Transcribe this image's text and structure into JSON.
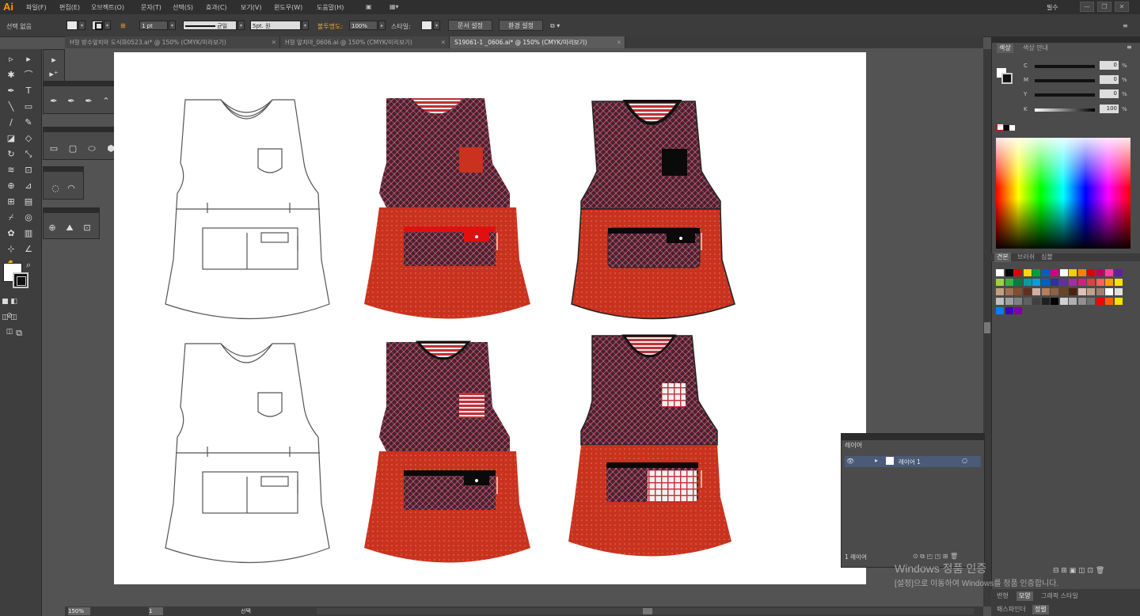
{
  "app": {
    "logo": "Ai"
  },
  "menu": [
    "파일(F)",
    "편집(E)",
    "오브젝트(O)",
    "문자(T)",
    "선택(S)",
    "효과(C)",
    "보기(V)",
    "윈도우(W)",
    "도움말(H)"
  ],
  "workspace": "필수",
  "window_controls": [
    "—",
    "❐",
    "✕"
  ],
  "control_bar": {
    "selection_label": "선택 없음",
    "stroke_weight": "1 pt",
    "stroke_style": "균일",
    "brush": "5pt. 원",
    "opacity_label": "불투명도:",
    "opacity_value": "100%",
    "style_label": "스타일:",
    "doc_setup": "문서 설정",
    "preferences": "환경 설정"
  },
  "tabs": [
    {
      "label": "H형 방수앞치마 도식화0523.ai* @ 150% (CMYK/미리보기)",
      "active": false
    },
    {
      "label": "H형 앞치마_0606.ai @ 150% (CMYK/미리보기)",
      "active": false
    },
    {
      "label": "S19061-1 _0606.ai* @ 150% (CMYK/미리보기)",
      "active": true
    }
  ],
  "color_panel": {
    "tabs": [
      "색상",
      "색상 안내"
    ],
    "channels": [
      {
        "name": "C",
        "value": "0"
      },
      {
        "name": "M",
        "value": "0"
      },
      {
        "name": "Y",
        "value": "0"
      },
      {
        "name": "K",
        "value": "100"
      }
    ],
    "pct": "%"
  },
  "swatch_panel": {
    "tabs": [
      "견본",
      "브러쉬",
      "심볼"
    ]
  },
  "layers_panel": {
    "title": "레이어",
    "layer_name": "레이어 1",
    "footer_count": "1 레이어"
  },
  "bottom_panel_tabs": [
    "변형",
    "모양",
    "그래픽 스타일"
  ],
  "bottom_panel_tabs2": [
    "패스파인더",
    "정렬"
  ],
  "status": {
    "zoom": "150%",
    "page": "1",
    "mode": "선택"
  },
  "watermark": {
    "line1": "Windows 정품 인증",
    "line2": "[설정]으로 이동하여 Windows를 정품 인증합니다."
  },
  "colors": {
    "fabric_red": "#c8321e",
    "fabric_dark": "#4a2030",
    "outline": "#555555",
    "accent_orange": "#ff9a00"
  }
}
